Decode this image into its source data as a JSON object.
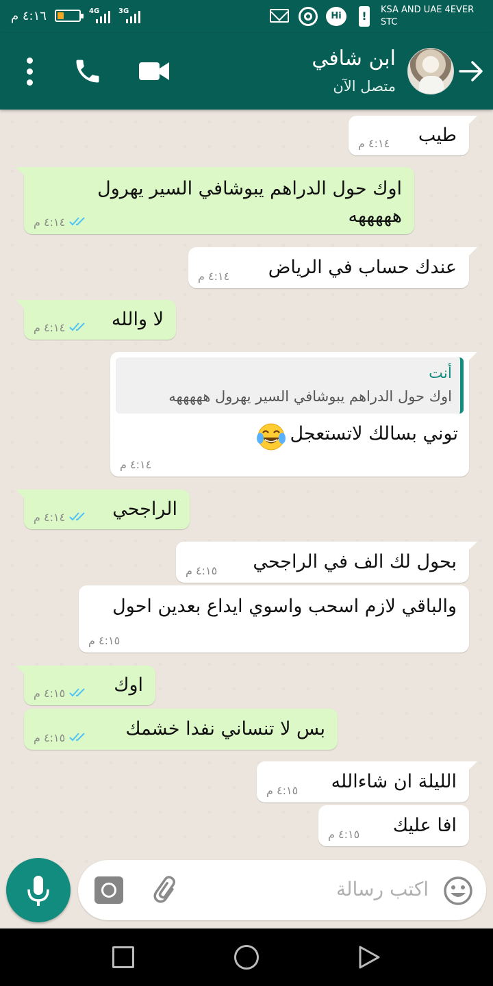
{
  "status_bar": {
    "time": "٤:١٦ م",
    "battery_level": 0.3,
    "network_1": "4G",
    "network_2": "3G",
    "carrier_line1": "KSA AND UAE 4EVER",
    "carrier_line2": "STC"
  },
  "header": {
    "contact_name": "ابن شافي",
    "contact_status": "متصل الآن"
  },
  "messages": [
    {
      "dir": "in",
      "text": "طيب",
      "time": "٤:١٤ م"
    },
    {
      "dir": "out",
      "text": "اوك حول الدراهم يبوشافي السير يهرول هههههه",
      "time": "٤:١٤ م",
      "read": true
    },
    {
      "dir": "in",
      "text": "عندك حساب في الرياض",
      "time": "٤:١٤ م"
    },
    {
      "dir": "out",
      "text": "لا والله",
      "time": "٤:١٤ م",
      "read": true
    },
    {
      "dir": "in",
      "text": "توني بسالك لاتستعجل",
      "time": "٤:١٤ م",
      "emoji": "tears-of-joy",
      "quote_author": "أنت",
      "quote_text": "اوك حول الدراهم يبوشافي السير يهرول هههههه"
    },
    {
      "dir": "out",
      "text": "الراجحي",
      "time": "٤:١٤ م",
      "read": true
    },
    {
      "dir": "in",
      "text": "بحول لك الف في الراجحي",
      "time": "٤:١٥ م"
    },
    {
      "dir": "in",
      "text": "والباقي لازم اسحب واسوي ايداع بعدين احول",
      "time": "٤:١٥ م"
    },
    {
      "dir": "out",
      "text": "اوك",
      "time": "٤:١٥ م",
      "read": true
    },
    {
      "dir": "out",
      "text": "بس لا تنساني نفدا خشمك",
      "time": "٤:١٥ م",
      "read": true
    },
    {
      "dir": "in",
      "text": "الليلة ان شاءالله",
      "time": "٤:١٥ م"
    },
    {
      "dir": "in",
      "text": "افا عليك",
      "time": "٤:١٥ م"
    }
  ],
  "input": {
    "placeholder": "اكتب رسالة"
  },
  "icons": {
    "back": "arrow-right-icon",
    "video": "video-camera-icon",
    "call": "phone-icon",
    "menu": "more-vert-icon",
    "emoji": "smiley-icon",
    "attach": "paperclip-icon",
    "camera": "camera-icon",
    "mic": "microphone-icon"
  },
  "colors": {
    "header": "#075e54",
    "outgoing_bubble": "#dcf8c6",
    "incoming_bubble": "#ffffff",
    "chat_bg": "#ece5dd",
    "accent": "#128c7e",
    "read_ticks": "#4fc3f7"
  }
}
